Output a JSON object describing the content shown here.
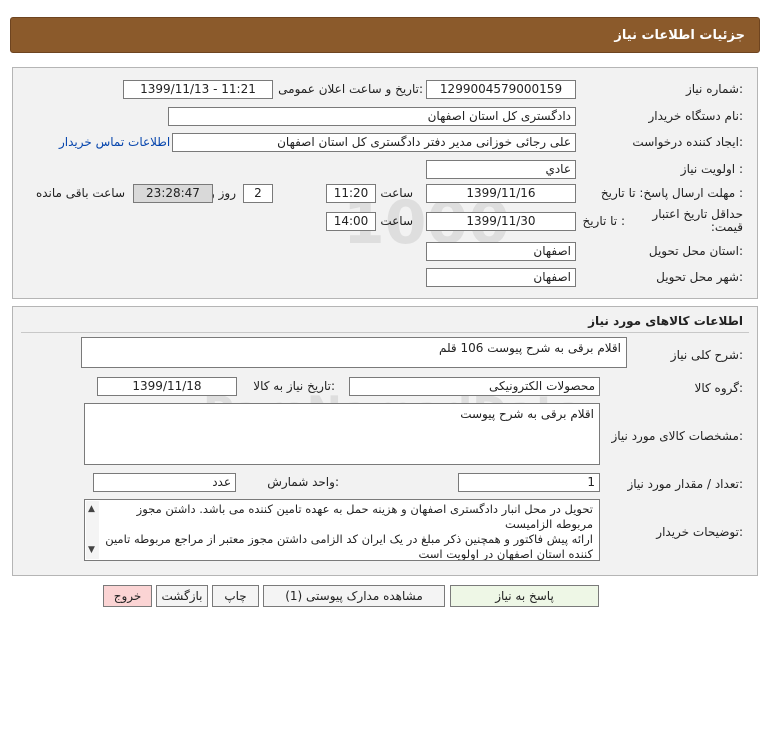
{
  "header": {
    "title": "جزئیات اطلاعات نیاز"
  },
  "info": {
    "need_number_label": "شماره نیاز:",
    "need_number": "1299004579000159",
    "announce_label": "تاریخ و ساعت اعلان عمومی:",
    "announce_value": "1399/11/13 - 11:21",
    "buyer_org_label": "نام دستگاه خریدار:",
    "buyer_org": "دادگستری کل استان اصفهان",
    "requester_label": "ایجاد کننده درخواست:",
    "requester": "علی رجائی خوزانی مدیر دفتر دادگستری کل استان اصفهان",
    "contact_link": "اطلاعات تماس خریدار",
    "priority_label": "اولویت نیاز :",
    "priority": "عادي",
    "deadline_label": "مهلت ارسال پاسخ: تا تاریخ :",
    "deadline_date": "1399/11/16",
    "time_label": "ساعت",
    "deadline_time": "11:20",
    "days_value": "2",
    "days_label": "روز و",
    "remaining_time": "23:28:47",
    "remaining_label": "ساعت باقی مانده",
    "validity_label": "حداقل تاریخ اعتبار قیمت:",
    "validity_until": "تا تاریخ :",
    "validity_date": "1399/11/30",
    "validity_time_label": "ساعت",
    "validity_time": "14:00",
    "province_label": "استان محل تحویل:",
    "province": "اصفهان",
    "city_label": "شهر محل تحویل:",
    "city": "اصفهان"
  },
  "goods": {
    "section_title": "اطلاعات کالاهای مورد نیاز",
    "desc_label": "شرح کلی نیاز:",
    "desc": "اقلام برقی به شرح پیوست 106 قلم",
    "group_label": "گروه کالا:",
    "group": "محصولات الکترونیکی",
    "need_date_label": "تاریخ نیاز به کالا:",
    "need_date": "1399/11/18",
    "specs_label": "مشخصات کالای مورد نیاز:",
    "specs": "اقلام برقی به شرح پیوست",
    "qty_label": "تعداد / مقدار مورد نیاز:",
    "qty": "1",
    "unit_label": "واحد شمارش:",
    "unit": "عدد",
    "notes_label": "توضیحات خریدار:",
    "notes_1": "تحویل در محل انبار دادگستری اصفهان و هزینه حمل به عهده تامین کننده می باشد. داشتن مجوز مربوطه الزامیست",
    "notes_2": "ارائه پیش فاکتور و همچنین ذکر مبلغ در یک ایران کد الزامی  داشتن مجوز معتبر از مراجع مربوطه تامین کننده استان اصفهان در اولویت است"
  },
  "buttons": {
    "reply": "پاسخ به نیاز",
    "attachments": "مشاهده مدارک پیوستی (1)",
    "print": "چاپ",
    "back": "بازگشت",
    "exit": "خروج"
  },
  "colors": {
    "header_bg": "#8b5a2b",
    "panel_bg": "#f2f2f2",
    "link": "#0645ad",
    "exit_bg": "#fbd4d4"
  }
}
